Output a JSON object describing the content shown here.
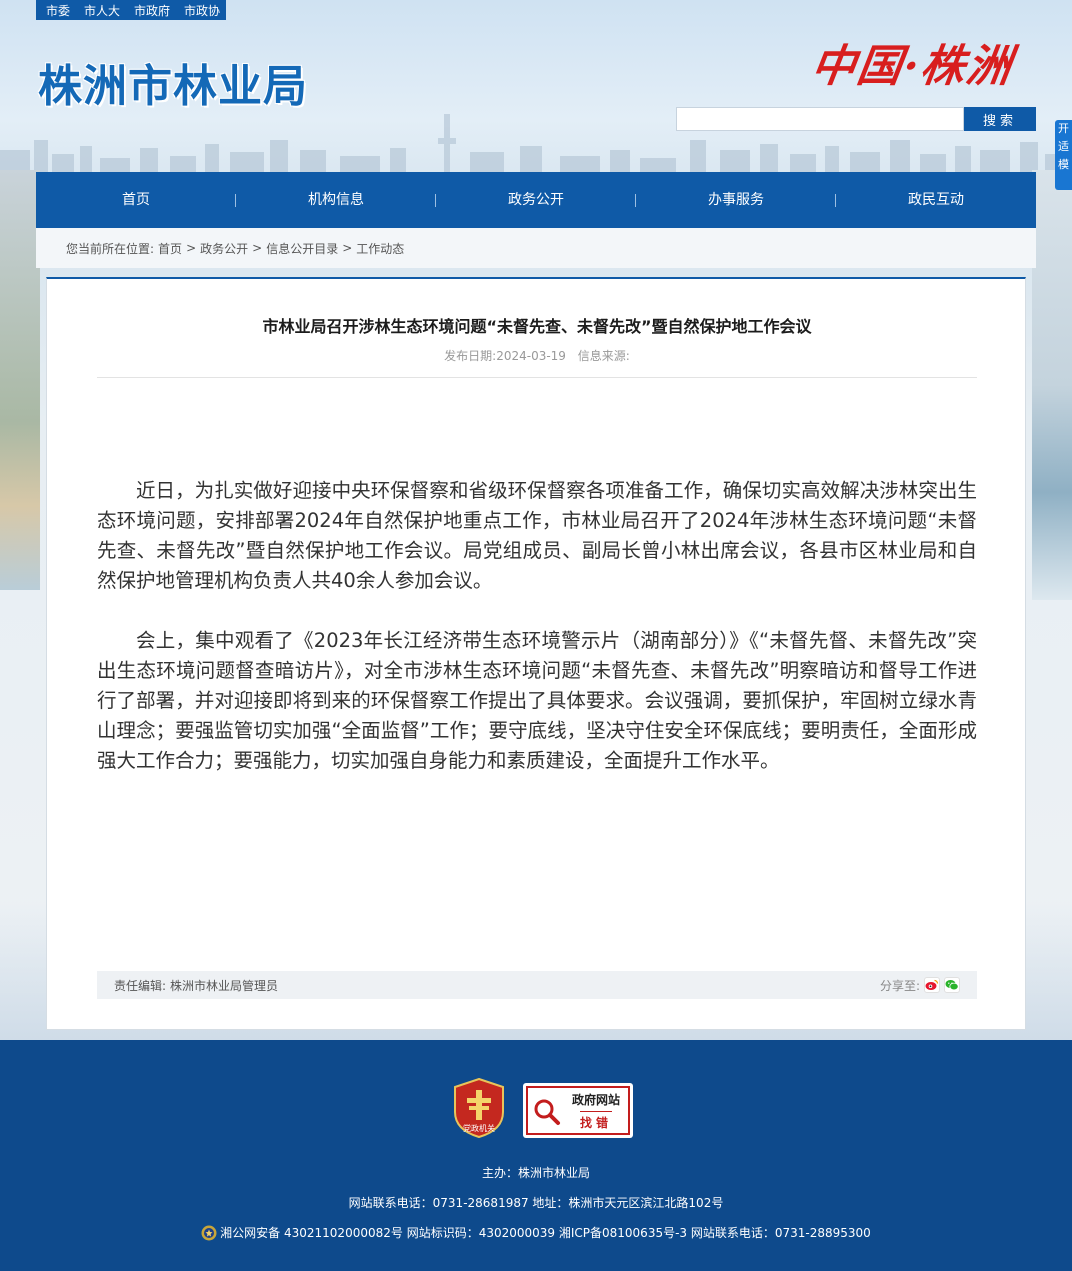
{
  "topbar": {
    "links": [
      "市委",
      "市人大",
      "市政府",
      "市政协"
    ]
  },
  "header": {
    "site_title": "株洲市林业局",
    "calligraphy": "中国·株洲",
    "search_button": "搜索",
    "search_placeholder": "",
    "side_tab": "开 适 模"
  },
  "nav": {
    "items": [
      "首页",
      "机构信息",
      "政务公开",
      "办事服务",
      "政民互动"
    ]
  },
  "breadcrumb": {
    "prefix": "您当前所在位置:",
    "items": [
      "首页",
      "政务公开",
      "信息公开目录",
      "工作动态"
    ],
    "sep": ">"
  },
  "article": {
    "title": "市林业局召开涉林生态环境问题“未督先查、未督先改”暨自然保护地工作会议",
    "date_label": "发布日期:",
    "date": "2024-03-19",
    "source_label": "信息来源:",
    "paragraphs": [
      "近日，为扎实做好迎接中央环保督察和省级环保督察各项准备工作，确保切实高效解决涉林突出生态环境问题，安排部署2024年自然保护地重点工作，市林业局召开了2024年涉林生态环境问题“未督先查、未督先改”暨自然保护地工作会议。局党组成员、副局长曾小林出席会议，各县市区林业局和自然保护地管理机构负责人共40余人参加会议。",
      "会上，集中观看了《2023年长江经济带生态环境警示片（湖南部分）》《“未督先督、未督先改”突出生态环境问题督查暗访片》，对全市涉林生态环境问题“未督先查、未督先改”明察暗访和督导工作进行了部署，并对迎接即将到来的环保督察工作提出了具体要求。会议强调，要抓保护，牢固树立绿水青山理念；要强监管切实加强“全面监督”工作；要守底线，坚决守住安全环保底线；要明责任，全面形成强大工作合力；要强能力，切实加强自身能力和素质建设，全面提升工作水平。"
    ],
    "editor_label": "责任编辑:",
    "editor": "株洲市林业局管理员",
    "share_label": "分享至:"
  },
  "footer": {
    "badge_text": "党政机关",
    "gov_error_line1": "政府网站",
    "gov_error_line2": "找错",
    "host": "主办：株洲市林业局",
    "contact": "网站联系电话：0731-28681987 地址：株洲市天元区滨江北路102号",
    "records": "湘公网安备 43021102000082号 网站标识码：4302000039 湘ICP备08100635号-3 网站联系电话：0731-28895300"
  },
  "colors": {
    "primary": "#0f5aa7",
    "footer": "#0e4a8c",
    "accent_red": "#d81e1e"
  }
}
